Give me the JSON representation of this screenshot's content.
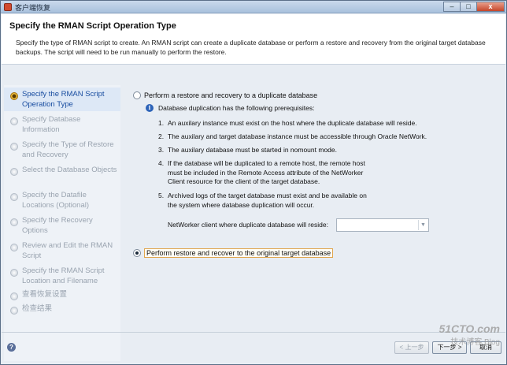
{
  "window": {
    "title": "客户端恢复",
    "controls": {
      "minimize": "–",
      "maximize": "□",
      "close": "x"
    }
  },
  "header": {
    "title": "Specify the RMAN Script Operation Type",
    "description": "Specify the type of RMAN script to create. An RMAN script can create a duplicate database or perform a restore and recovery from the original target database backups.  The script will need to be run manually to perform the restore."
  },
  "sidebar": {
    "steps": [
      {
        "label": "Specify the RMAN Script Operation Type",
        "active": true
      },
      {
        "label": "Specify Database Information",
        "active": false
      },
      {
        "label": "Specify the Type of Restore and Recovery",
        "active": false
      },
      {
        "label": "Select the Database Objects",
        "active": false
      },
      {
        "label": "Specify the Datafile Locations (Optional)",
        "active": false
      },
      {
        "label": "Specify the Recovery Options",
        "active": false
      },
      {
        "label": "Review and Edit the RMAN Script",
        "active": false
      },
      {
        "label": "Specify the RMAN Script Location and Filename",
        "active": false
      },
      {
        "label": "查看恢复设置",
        "active": false
      },
      {
        "label": "检查结果",
        "active": false
      }
    ],
    "help": "?"
  },
  "main": {
    "option_duplicate": "Perform a restore and recovery to a duplicate database",
    "info": "Database duplication has the following prerequisites:",
    "requirements": [
      {
        "num": "1.",
        "text": "An auxilary instance must exist on the host where the duplicate database will reside."
      },
      {
        "num": "2.",
        "text": "The auxilary and target database instance must be accessible through Oracle NetWork."
      },
      {
        "num": "3.",
        "text": "The auxilary database must be started in nomount mode."
      },
      {
        "num": "4.",
        "text": "If the database will be duplicated to a remote host, the remote host must be included in the Remote Access attribute of the NetWorker Client resource for the client of the target database."
      },
      {
        "num": "5.",
        "text": "Archived logs of the target database must exist and be available on the system where database duplication will occur."
      }
    ],
    "client_label": "NetWorker client where duplicate database will reside:",
    "client_value": "",
    "option_original": "Perform restore and recover to the original target database",
    "selected_option": "original"
  },
  "footer": {
    "back": "< 上一步",
    "next": "下一步 >",
    "cancel": "取消"
  },
  "watermark": {
    "logo": "51CTO.com",
    "sub": "技术博客 Blog"
  }
}
